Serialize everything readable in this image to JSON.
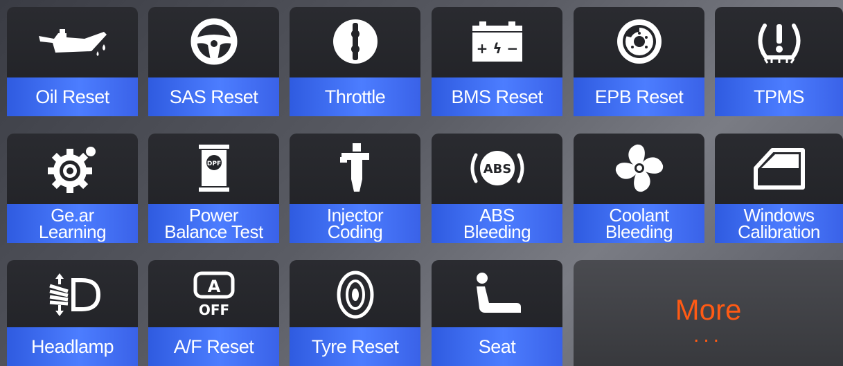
{
  "tiles": [
    {
      "label": "Oil Reset",
      "icon": "oil-can-icon"
    },
    {
      "label": "SAS Reset",
      "icon": "steering-wheel-icon"
    },
    {
      "label": "Throttle",
      "icon": "throttle-icon"
    },
    {
      "label": "BMS Reset",
      "icon": "battery-icon"
    },
    {
      "label": "EPB Reset",
      "icon": "brake-disc-icon"
    },
    {
      "label": "TPMS",
      "icon": "tire-pressure-icon"
    },
    {
      "label": "Ge.ar\nLearning",
      "icon": "gear-icon"
    },
    {
      "label": "Power\nBalance Test",
      "icon": "dpf-icon"
    },
    {
      "label": "Injector\nCoding",
      "icon": "injector-icon"
    },
    {
      "label": "ABS\nBleeding",
      "icon": "abs-icon"
    },
    {
      "label": "Coolant\nBleeding",
      "icon": "fan-icon"
    },
    {
      "label": "Windows\nCalibration",
      "icon": "car-window-icon"
    },
    {
      "label": "Headlamp",
      "icon": "headlamp-icon"
    },
    {
      "label": "A/F Reset",
      "icon": "auto-off-icon"
    },
    {
      "label": "Tyre Reset",
      "icon": "tyre-icon"
    },
    {
      "label": "Seat",
      "icon": "seat-icon"
    }
  ],
  "icon_text": {
    "battery": "+ ϟ −",
    "dpf": "DPF",
    "abs": "ABS",
    "auto_letter": "A",
    "auto_off": "OFF"
  },
  "more": {
    "label": "More",
    "dots": "..."
  },
  "colors": {
    "label_blue": "#4c7dff",
    "tile_bg": "#232428",
    "more_orange": "#ff5a14"
  }
}
